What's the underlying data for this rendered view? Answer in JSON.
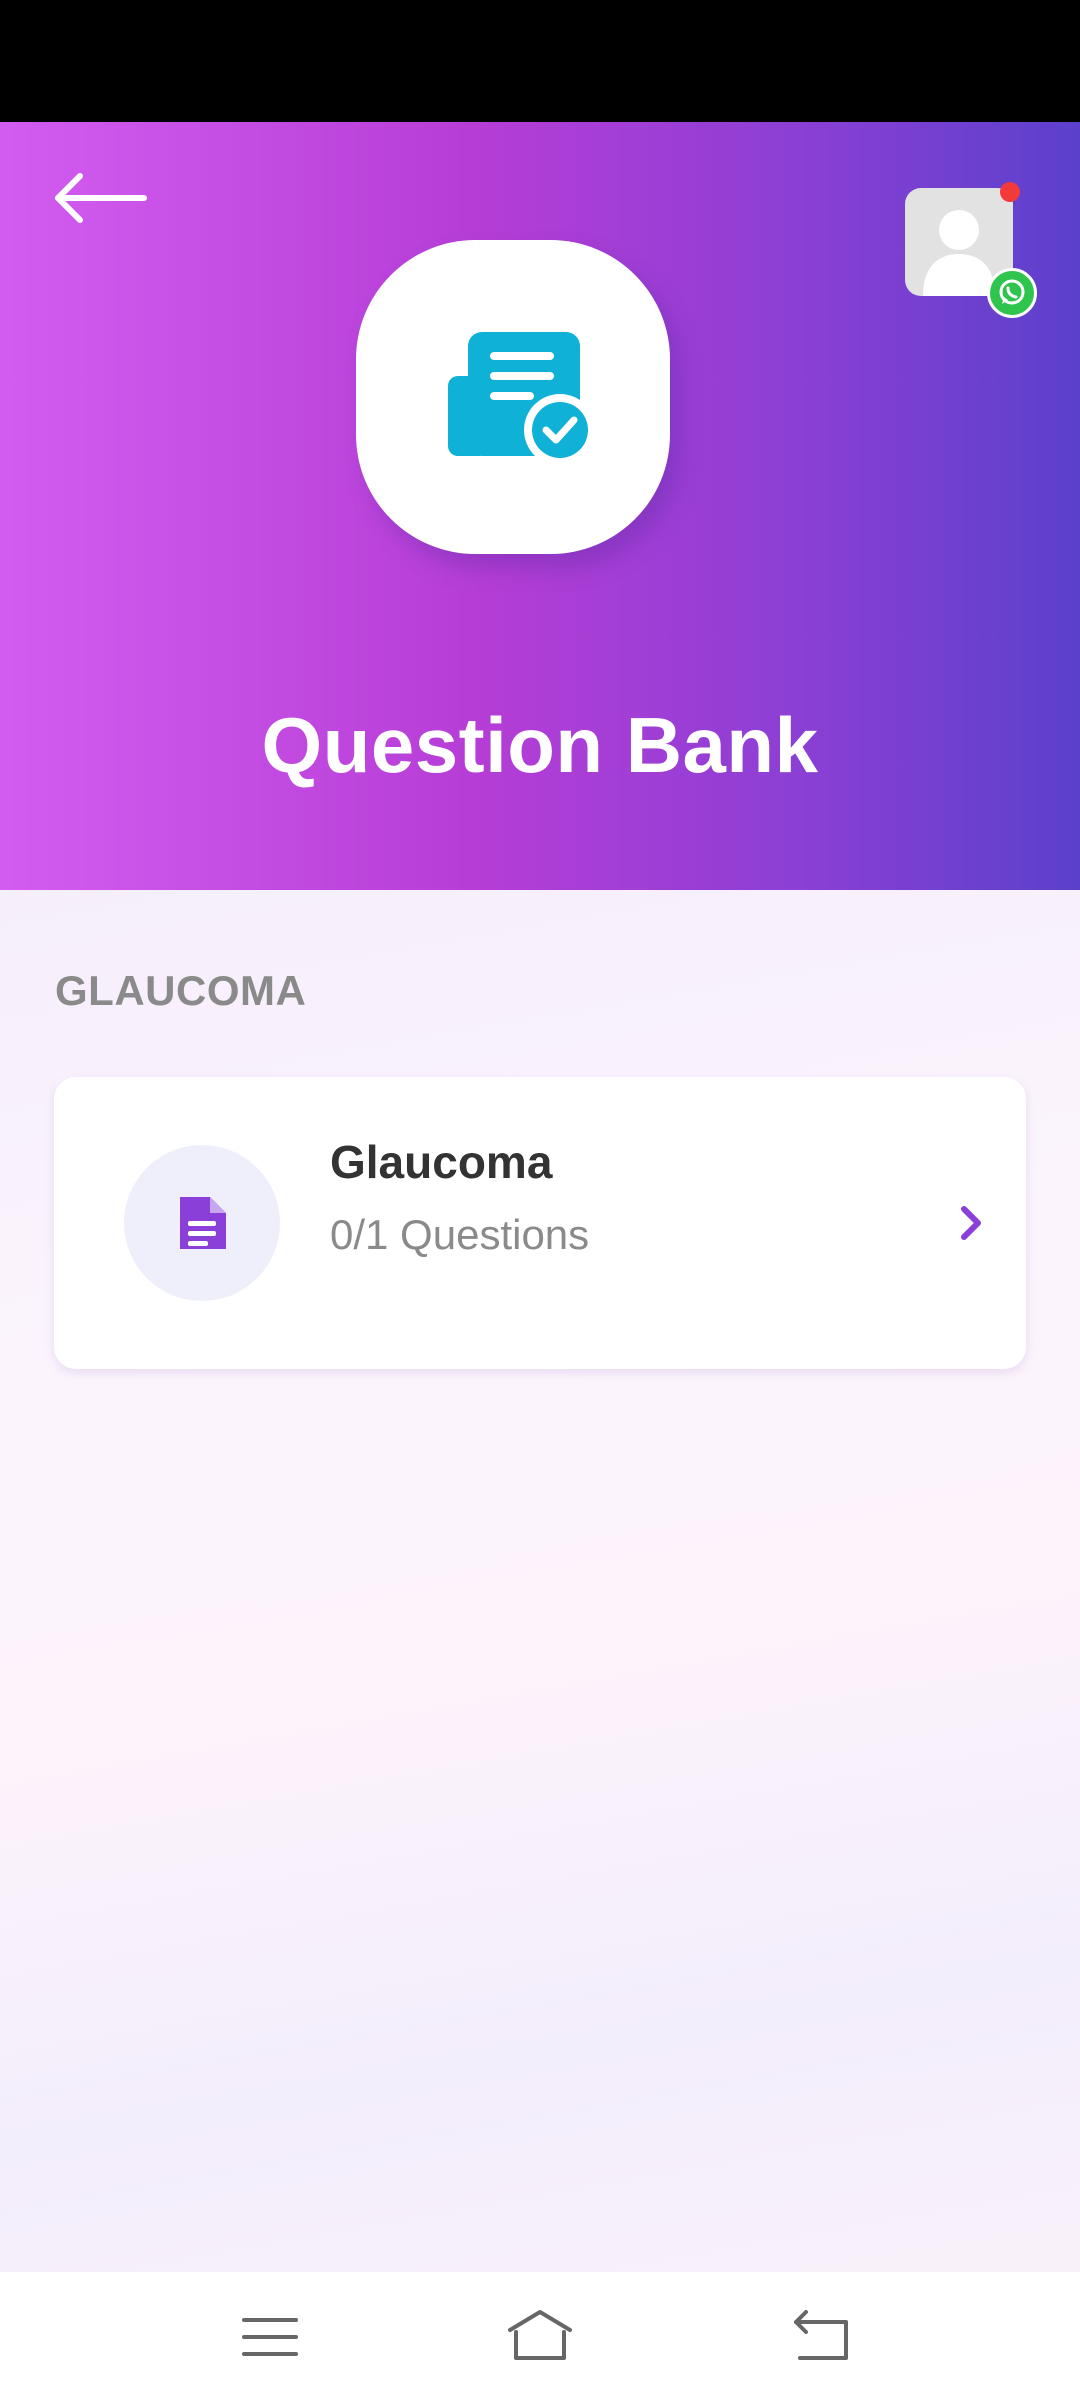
{
  "header": {
    "title": "Question Bank",
    "gradient_start": "#d35cf0",
    "gradient_end": "#5b40cc",
    "back_icon": "arrow-left-icon",
    "app_icon": "document-check-icon",
    "avatar_icon": "user-silhouette-icon",
    "badge_icon": "whatsapp-icon"
  },
  "section": {
    "title": "GLAUCOMA"
  },
  "items": [
    {
      "title": "Glaucoma",
      "subtitle": "0/1 Questions",
      "icon": "document-icon",
      "accent": "#8b3fd9"
    }
  ],
  "nav": {
    "items": [
      "menu-icon",
      "home-icon",
      "back-icon"
    ]
  }
}
